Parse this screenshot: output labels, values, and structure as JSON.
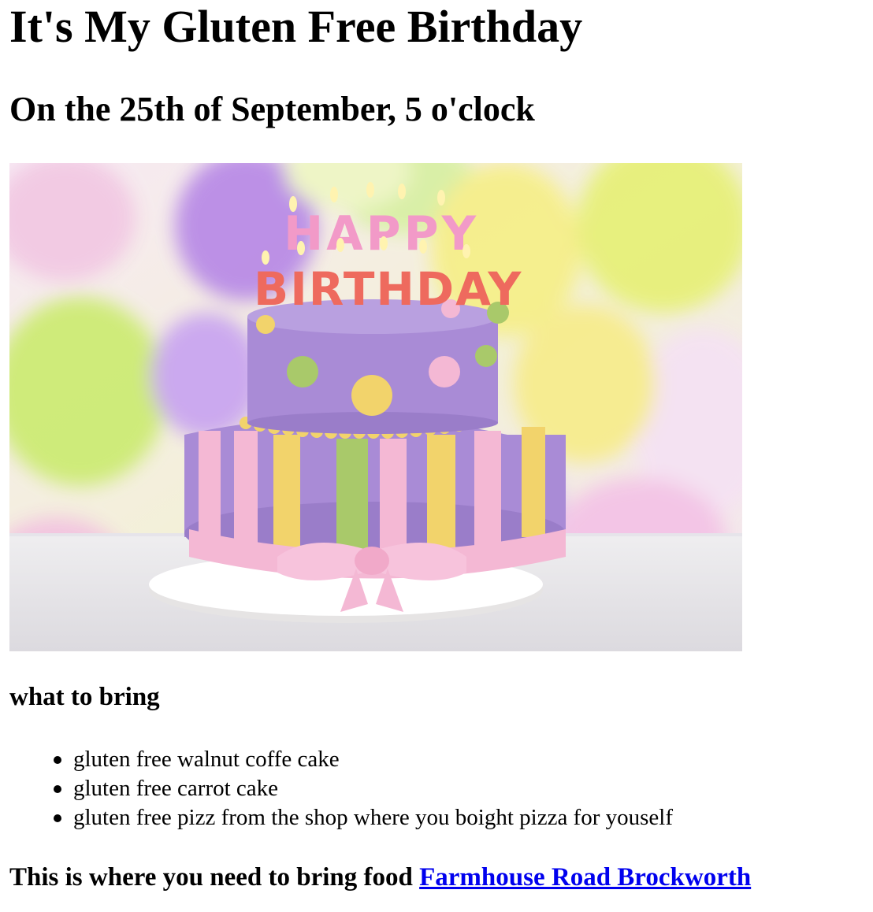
{
  "page": {
    "title": "It's My Gluten Free Birthday",
    "subtitle": "On the 25th of September, 5 o'clock",
    "image": {
      "alt": "Happy Birthday cake with candles and balloons",
      "candle_letters_top": "HAPPY",
      "candle_letters_bottom": "BIRTHDAY"
    },
    "list_heading": "what to bring",
    "items": [
      "gluten free walnut coffe cake",
      "gluten free carrot cake",
      "gluten free pizz from the shop where you boight pizza for youself"
    ],
    "footer_text": "This is where you need to bring food ",
    "location_link": "Farmhouse Road Brockworth"
  },
  "colors": {
    "link": "#0000ee",
    "cake_purple": "#a98bd6",
    "cake_pink": "#f4b8d4",
    "cake_yellow": "#f2d36b",
    "cake_green": "#a9c96a"
  }
}
